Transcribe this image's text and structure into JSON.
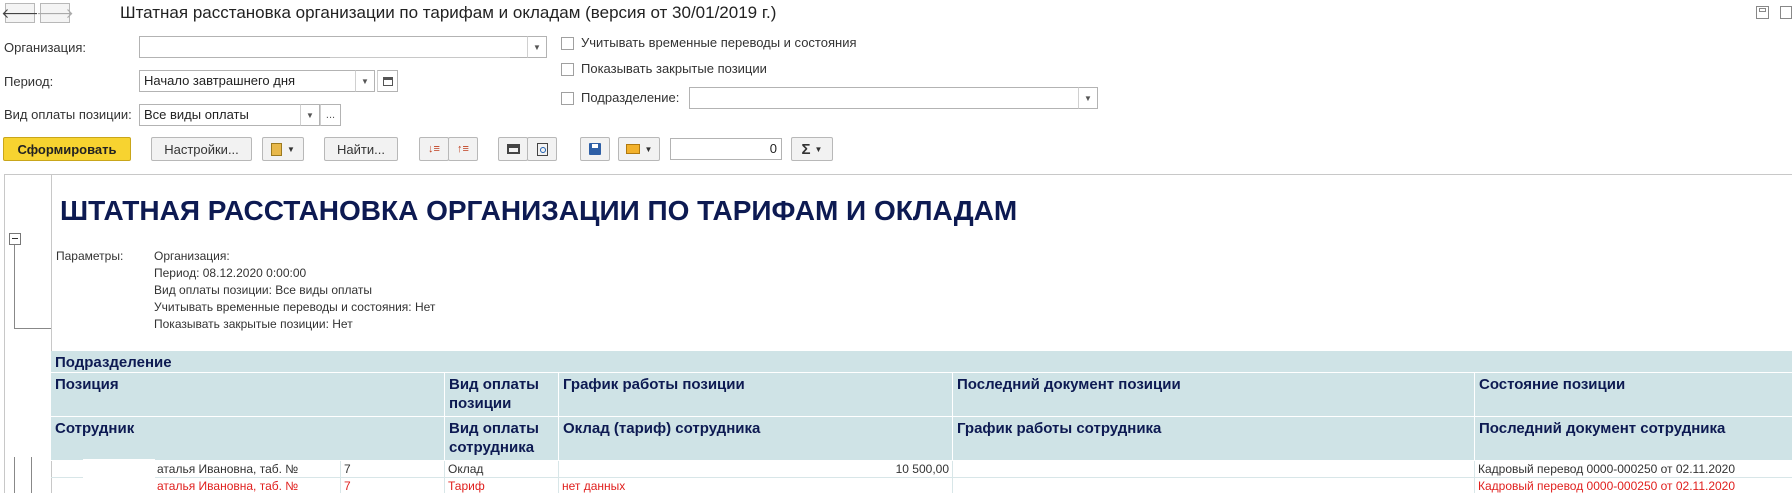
{
  "window": {
    "title": "Штатная расстановка организации по тарифам и окладам (версия от 30/01/2019 г.)",
    "back_icon": "arrow-left-icon",
    "forward_icon": "arrow-right-icon"
  },
  "filters": {
    "organization_label": "Организация:",
    "organization_value": "",
    "period_label": "Период:",
    "period_value": "Начало завтрашнего дня",
    "payment_type_label": "Вид оплаты позиции:",
    "payment_type_value": "Все виды оплаты",
    "ellipsis": "...",
    "temp_transfers_label": "Учитывать временные переводы и состояния",
    "show_closed_label": "Показывать закрытые позиции",
    "subdivision_label": "Подразделение:",
    "subdivision_value": ""
  },
  "toolbar": {
    "generate": "Сформировать",
    "settings": "Настройки...",
    "find": "Найти...",
    "counter_value": "0",
    "sum_symbol": "Σ"
  },
  "report": {
    "heading": "ШТАТНАЯ РАССТАНОВКА ОРГАНИЗАЦИИ ПО ТАРИФАМ И ОКЛАДАМ",
    "params_label": "Параметры:",
    "params": [
      "Организация:",
      "Период: 08.12.2020 0:00:00",
      "Вид оплаты позиции: Все виды оплаты",
      "Учитывать временные переводы и состояния: Нет",
      "Показывать закрытые позиции: Нет"
    ],
    "header": {
      "subdivision": "Подразделение",
      "position": "Позиция",
      "position_payment": "Вид оплаты позиции",
      "position_schedule": "График работы позиции",
      "position_last_doc": "Последний документ позиции",
      "position_state": "Состояние позиции",
      "employee": "Сотрудник",
      "employee_payment": "Вид оплаты сотрудника",
      "employee_salary": "Оклад (тариф) сотрудника",
      "employee_schedule": "График работы сотрудника",
      "employee_last_doc": "Последний документ сотрудника"
    },
    "rows": [
      {
        "employee": "аталья Ивановна, таб. №",
        "tab_no": "7",
        "payment": "Оклад",
        "salary": "10 500,00",
        "schedule": "",
        "last_doc": "Кадровый перевод 0000-000250 от 02.11.2020",
        "highlight": false
      },
      {
        "employee": "аталья Ивановна, таб. №",
        "tab_no": "7",
        "payment": "Тариф",
        "salary": "нет данных",
        "schedule": "",
        "last_doc": "Кадровый перевод 0000-000250 от 02.11.2020",
        "highlight": true
      }
    ]
  },
  "colors": {
    "accent_yellow": "#f7d330",
    "header_bg": "#cfe3e6",
    "header_text": "#0d1a52",
    "error_red": "#e0201e"
  }
}
